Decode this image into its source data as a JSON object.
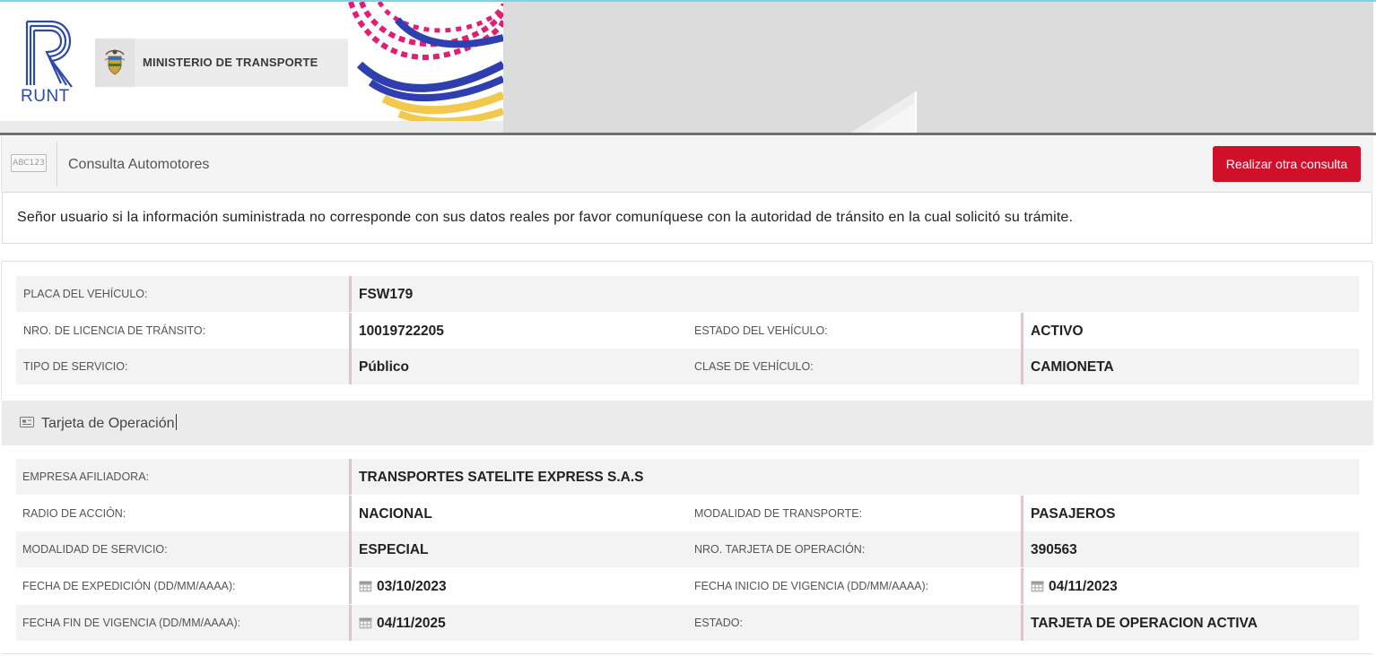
{
  "header": {
    "runt_logo_text": "RUNT",
    "ministry_name": "MINISTERIO DE TRANSPORTE"
  },
  "consulta": {
    "icon_text": "ABC123",
    "title": "Consulta Automotores",
    "button_label": "Realizar otra consulta"
  },
  "notice": {
    "text": "Señor usuario si la información suministrada no corresponde con sus datos reales por favor comuníquese con la autoridad de tránsito en la cual solicitó su trámite."
  },
  "vehicle": {
    "placa_label": "PLACA DEL VEHÍCULO:",
    "placa_value": "FSW179",
    "licencia_label": "NRO. DE LICENCIA DE TRÁNSITO:",
    "licencia_value": "10019722205",
    "estado_label": "ESTADO DEL VEHÍCULO:",
    "estado_value": "ACTIVO",
    "servicio_label": "TIPO DE SERVICIO:",
    "servicio_value": "Público",
    "clase_label": "CLASE DE VEHÍCULO:",
    "clase_value": "CAMIONETA"
  },
  "tarjeta": {
    "section_title": "Tarjeta de Operación",
    "empresa_label": "EMPRESA AFILIADORA:",
    "empresa_value": "TRANSPORTES SATELITE EXPRESS S.A.S",
    "radio_label": "RADIO DE ACCIÓN:",
    "radio_value": "NACIONAL",
    "modalidad_transporte_label": "MODALIDAD DE TRANSPORTE:",
    "modalidad_transporte_value": "PASAJEROS",
    "modalidad_servicio_label": "MODALIDAD DE SERVICIO:",
    "modalidad_servicio_value": "ESPECIAL",
    "nro_tarjeta_label": "NRO. TARJETA DE OPERACIÓN:",
    "nro_tarjeta_value": "390563",
    "fecha_exp_label": "FECHA DE EXPEDICIÓN (DD/MM/AAAA):",
    "fecha_exp_value": "03/10/2023",
    "fecha_inicio_label": "FECHA INICIO DE VIGENCIA (DD/MM/AAAA):",
    "fecha_inicio_value": "04/11/2023",
    "fecha_fin_label": "FECHA FIN DE VIGENCIA (DD/MM/AAAA):",
    "fecha_fin_value": "04/11/2025",
    "estado_label": "ESTADO:",
    "estado_value": "TARJETA DE OPERACION ACTIVA"
  },
  "icons": {
    "calendar": "calendar-icon",
    "card": "id-card-icon",
    "plate": "license-plate-icon"
  },
  "colors": {
    "accent_red": "#d0102a",
    "runt_blue": "#2e4aa8",
    "value_bar": "#dec6cb"
  }
}
